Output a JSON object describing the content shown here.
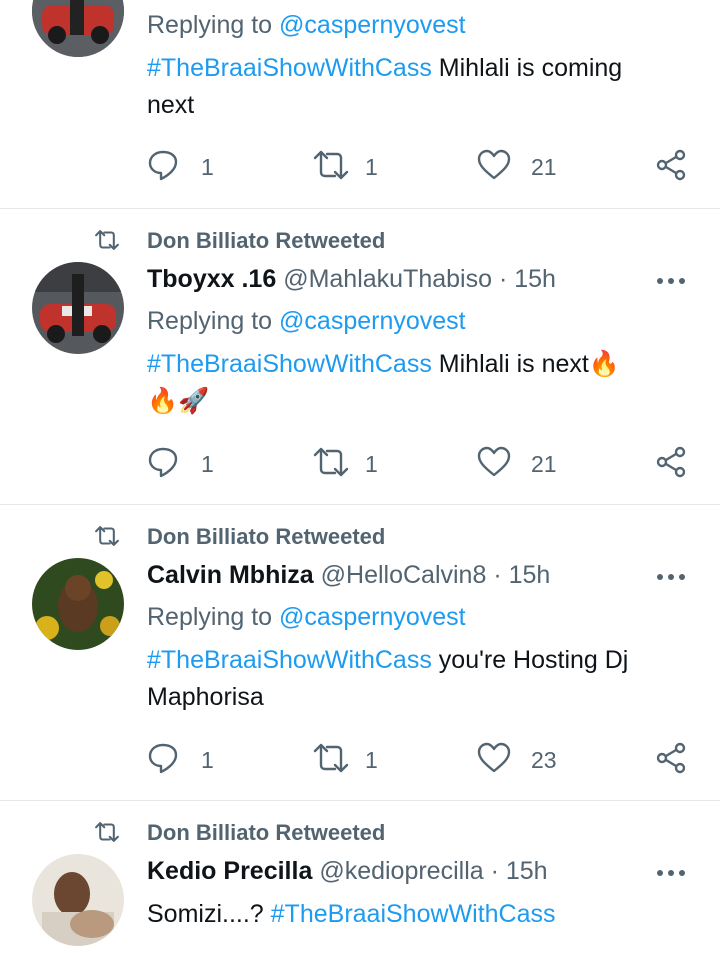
{
  "colors": {
    "accent": "#1d9bf0",
    "muted": "#536471",
    "text": "#0f1419",
    "divider": "#e6e9eb"
  },
  "tweets": [
    {
      "retweeter_text": "",
      "name": "",
      "handle": "",
      "time": "",
      "replying_prefix": "Replying to",
      "replying_to": "@caspernyovest",
      "hashtag": "#TheBraaiShowWithCass",
      "text_line1": " Mihlali is coming",
      "text_line2": "next",
      "replies": "1",
      "retweets": "1",
      "likes": "21"
    },
    {
      "retweeter_text": "Don Billiato Retweeted",
      "name": "Tboyxx .16",
      "handle": "@MahlakuThabiso",
      "time": "15h",
      "replying_prefix": "Replying to",
      "replying_to": "@caspernyovest",
      "hashtag": "#TheBraaiShowWithCass",
      "text_line1": " Mihlali is next🔥",
      "text_line2": "🔥🚀",
      "replies": "1",
      "retweets": "1",
      "likes": "21"
    },
    {
      "retweeter_text": "Don Billiato Retweeted",
      "name": "Calvin Mbhiza",
      "handle": "@HelloCalvin8",
      "time": "15h",
      "replying_prefix": "Replying to",
      "replying_to": "@caspernyovest",
      "hashtag": "#TheBraaiShowWithCass",
      "text_line1": " you're Hosting Dj",
      "text_line2": "Maphorisa",
      "replies": "1",
      "retweets": "1",
      "likes": "23"
    },
    {
      "retweeter_text": "Don Billiato Retweeted",
      "name": "Kedio Precilla",
      "handle": "@kedioprecilla",
      "time": "15h",
      "text_prefix": "Somizi....? ",
      "hashtag": "#TheBraaiShowWithCass"
    }
  ],
  "separator": " · ",
  "icons": {
    "reply": "reply-icon",
    "retweet": "retweet-icon",
    "like": "heart-icon",
    "share": "share-icon",
    "more": "more-icon"
  }
}
